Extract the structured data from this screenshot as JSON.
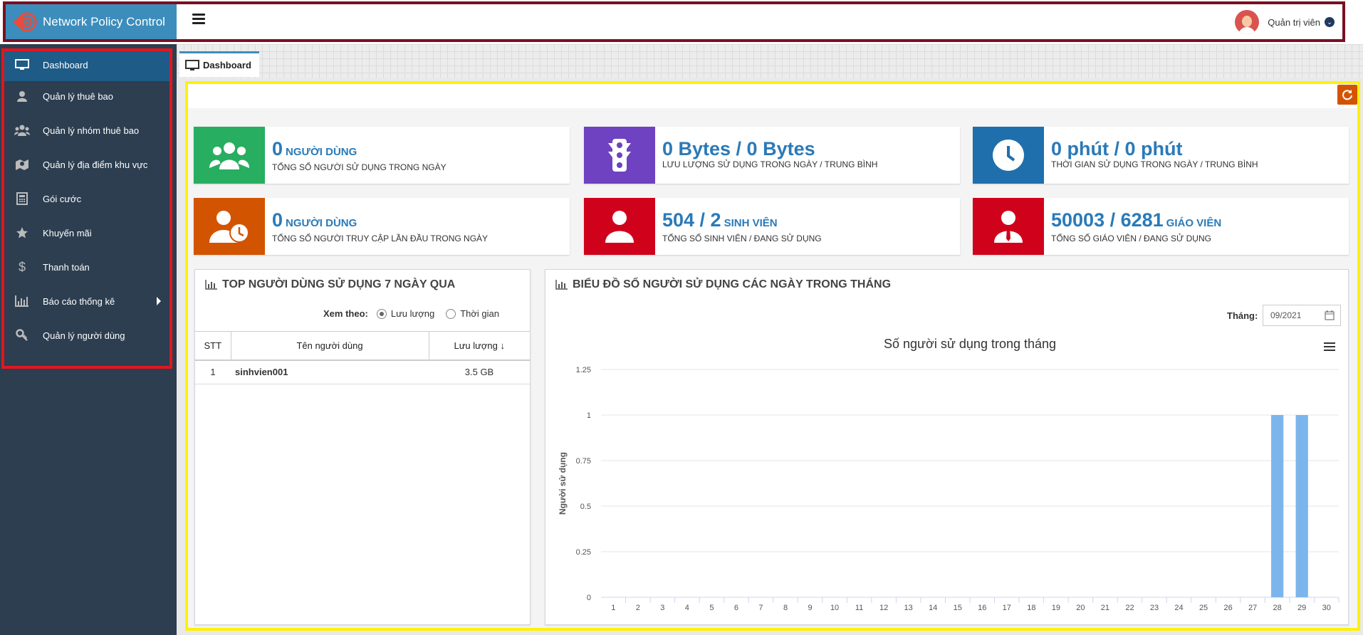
{
  "app": {
    "title": "Network Policy Control"
  },
  "user": {
    "name": "Quản trị viên"
  },
  "sidebar": {
    "items": [
      {
        "label": "Dashboard",
        "icon": "monitor-icon"
      },
      {
        "label": "Quản lý thuê bao",
        "icon": "user-icon"
      },
      {
        "label": "Quản lý nhóm thuê bao",
        "icon": "users-icon"
      },
      {
        "label": "Quản lý địa điểm khu vực",
        "icon": "map-icon"
      },
      {
        "label": "Gói cước",
        "icon": "calculator-icon"
      },
      {
        "label": "Khuyến mãi",
        "icon": "star-icon"
      },
      {
        "label": "Thanh toán",
        "icon": "dollar-icon"
      },
      {
        "label": "Báo cáo thống kê",
        "icon": "bar-chart-icon"
      },
      {
        "label": "Quản lý người dùng",
        "icon": "key-icon"
      }
    ]
  },
  "tabs": [
    {
      "label": "Dashboard"
    }
  ],
  "stats": [
    {
      "value": "0",
      "unit": "Người dùng",
      "desc": "Tổng số người sử dụng trong ngày",
      "color": "#27ae60",
      "icon": "users-icon"
    },
    {
      "value": "0 Bytes / 0 Bytes",
      "unit": "",
      "desc": "Lưu lượng sử dụng trong ngày / trung bình",
      "color": "#6f42c1",
      "icon": "traffic-light-icon"
    },
    {
      "value": "0 phút / 0 phút",
      "unit": "",
      "desc": "Thời gian sử dụng trong ngày / trung bình",
      "color": "#1f6fad",
      "icon": "clock-icon"
    },
    {
      "value": "0",
      "unit": "Người dùng",
      "desc": "Tổng số người truy cập lần đầu trong ngày",
      "color": "#d35400",
      "icon": "user-clock-icon"
    },
    {
      "value": "504 / 2",
      "unit": "Sinh viên",
      "desc": "Tổng số sinh viên / đang sử dụng",
      "color": "#d0021b",
      "icon": "student-icon"
    },
    {
      "value": "50003 / 6281",
      "unit": "Giáo viên",
      "desc": "Tổng số giáo viên / đang sử dụng",
      "color": "#d0021b",
      "icon": "teacher-icon"
    }
  ],
  "top_users": {
    "title": "TOP NGƯỜI DÙNG SỬ DỤNG 7 NGÀY QUA",
    "filter_label": "Xem theo:",
    "options": [
      "Lưu lượng",
      "Thời gian"
    ],
    "selected": "Lưu lượng",
    "columns": [
      "STT",
      "Tên người dùng",
      "Lưu lượng"
    ],
    "rows": [
      {
        "stt": "1",
        "name": "sinhvien001",
        "usage": "3.5 GB"
      }
    ]
  },
  "usage_chart": {
    "panel_title": "BIỂU ĐỒ SỐ NGƯỜI SỬ DỤNG CÁC NGÀY TRONG THÁNG",
    "month_label": "Tháng:",
    "month_value": "09/2021"
  },
  "chart_data": {
    "type": "bar",
    "title": "Số người sử dụng trong tháng",
    "xlabel": "",
    "ylabel": "Người sử dụng",
    "categories": [
      "1",
      "2",
      "3",
      "4",
      "5",
      "6",
      "7",
      "8",
      "9",
      "10",
      "11",
      "12",
      "13",
      "14",
      "15",
      "16",
      "17",
      "18",
      "19",
      "20",
      "21",
      "22",
      "23",
      "24",
      "25",
      "26",
      "27",
      "28",
      "29",
      "30"
    ],
    "values": [
      0,
      0,
      0,
      0,
      0,
      0,
      0,
      0,
      0,
      0,
      0,
      0,
      0,
      0,
      0,
      0,
      0,
      0,
      0,
      0,
      0,
      0,
      0,
      0,
      0,
      0,
      0,
      1,
      1,
      0
    ],
    "ylim": [
      0,
      1.25
    ],
    "yticks": [
      "0",
      "0.25",
      "0.5",
      "0.75",
      "1",
      "1.25"
    ],
    "grid": true,
    "bar_color": "#7cb5ec"
  }
}
